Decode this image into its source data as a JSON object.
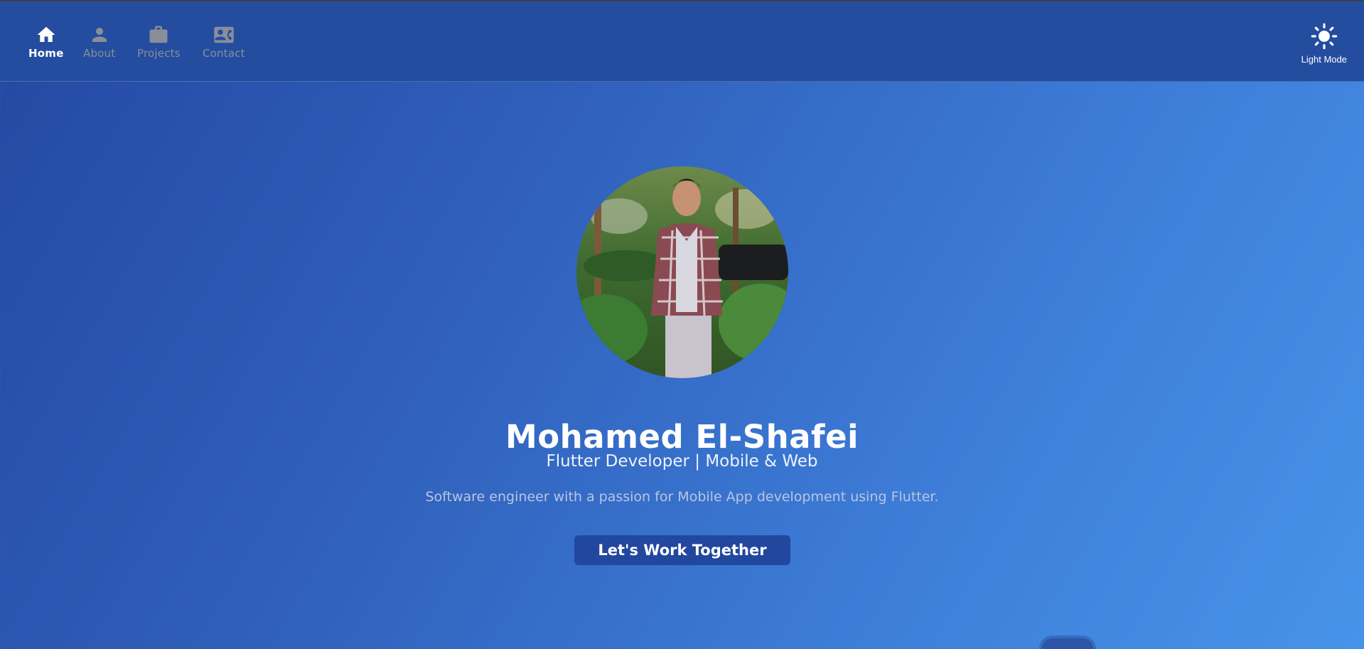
{
  "nav": {
    "items": [
      {
        "label": "Home",
        "icon": "home-icon",
        "active": true
      },
      {
        "label": "About",
        "icon": "person-icon",
        "active": false
      },
      {
        "label": "Projects",
        "icon": "briefcase-icon",
        "active": false
      },
      {
        "label": "Contact",
        "icon": "contact-card-icon",
        "active": false
      }
    ]
  },
  "theme_toggle": {
    "label": "Light Mode",
    "icon": "sun-icon"
  },
  "hero": {
    "name": "Mohamed El-Shafei",
    "role": "Flutter Developer | Mobile & Web",
    "tagline": "Software engineer with a passion for Mobile App development using Flutter.",
    "cta_label": "Let's Work Together"
  },
  "colors": {
    "navbar_bg": "#244da0",
    "gradient_start": "#2448a2",
    "gradient_end": "#4793ea",
    "button_bg": "#22479f",
    "nav_inactive": "#8a8e98"
  }
}
